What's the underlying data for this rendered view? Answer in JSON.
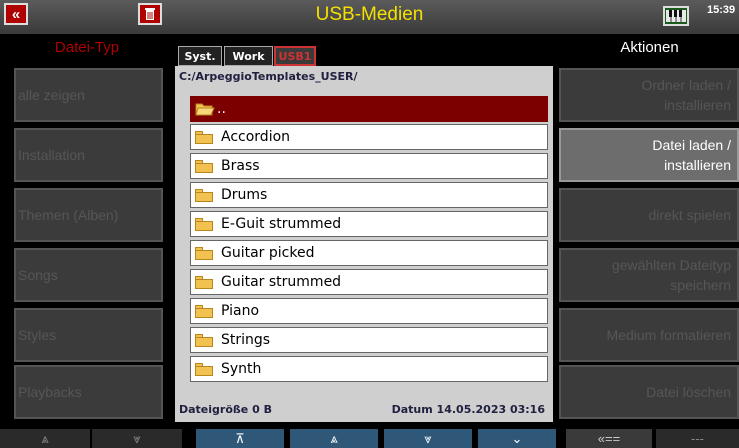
{
  "header": {
    "title": "USB-Medien",
    "clock": "15:39",
    "back_label": "«",
    "trash_icon": "trash-icon",
    "keyboard_icon": "keyboard-icon"
  },
  "left_panel": {
    "header": "Datei-Typ",
    "items": [
      {
        "label": "alle zeigen"
      },
      {
        "label": "Installation"
      },
      {
        "label": "Themen (Alben)"
      },
      {
        "label": "Songs"
      },
      {
        "label": "Styles"
      },
      {
        "label": "Playbacks"
      }
    ]
  },
  "right_panel": {
    "header": "Aktionen",
    "items": [
      {
        "line1": "Ordner laden /",
        "line2": "installieren",
        "active": false
      },
      {
        "line1": "Datei laden /",
        "line2": "installieren",
        "active": true
      },
      {
        "line1": "direkt spielen",
        "line2": "",
        "active": false
      },
      {
        "line1": "gewählten Dateityp",
        "line2": "speichern",
        "active": false
      },
      {
        "line1": "Medium formatieren",
        "line2": "",
        "active": false
      },
      {
        "line1": "Datei löschen",
        "line2": "",
        "active": false
      }
    ]
  },
  "tabs": [
    {
      "label": "Syst."
    },
    {
      "label": "Work"
    },
    {
      "label": "USB1"
    }
  ],
  "browser": {
    "path": "C:/ArpeggioTemplates_USER/",
    "up_label": "..",
    "folders": [
      "Accordion",
      "Brass",
      "Drums",
      "E-Guit strummed",
      "Guitar picked",
      "Guitar strummed",
      "Piano",
      "Strings",
      "Synth"
    ],
    "file_size": "Dateigröße 0 B",
    "date": "Datum 14.05.2023  03:16"
  },
  "bottom_bar": {
    "btn1": "⩓",
    "btn2": "⩔",
    "btn3": "⊼",
    "btn4": "⩓",
    "btn5": "⩔",
    "btn6": "⌄",
    "btn7": "«==",
    "btn8": "---"
  },
  "colors": {
    "accent_red": "#b00000",
    "title_yellow": "#f5e000",
    "selected_row": "#7d0000",
    "nav_blue": "#2f5878"
  }
}
